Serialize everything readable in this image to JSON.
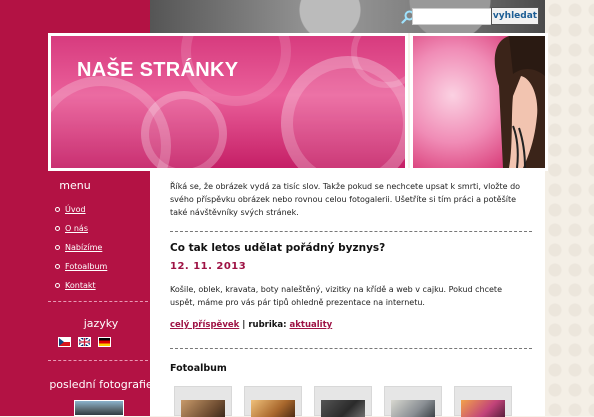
{
  "search": {
    "placeholder": "",
    "button_label": "vyhledat"
  },
  "header": {
    "site_title": "NAŠE STRÁNKY"
  },
  "sidebar": {
    "menu_heading": "menu",
    "items": [
      {
        "label": "Úvod"
      },
      {
        "label": "O nás"
      },
      {
        "label": "Nabízíme"
      },
      {
        "label": "Fotoalbum"
      },
      {
        "label": "Kontakt"
      }
    ],
    "languages_heading": "jazyky",
    "languages": [
      "cs",
      "en",
      "de"
    ],
    "recent_photos_heading": "poslední fotografie"
  },
  "content": {
    "intro": "Říká se, že obrázek vydá za tisíc slov. Takže pokud se nechcete upsat k smrti, vložte do svého příspěvku obrázek nebo rovnou celou fotogalerii. Ušetříte si tím práci a potěšíte také návštěvníky svých stránek.",
    "post": {
      "title": "Co tak letos udělat pořádný byznys?",
      "date": "12. 11. 2013",
      "body": "Košile, oblek, kravata, boty naleštěný, vizitky na křídě a web v cajku. Pokud chcete uspět, máme pro vás pár tipů ohledně prezentace na internetu.",
      "full_post_link": "celý příspěvek",
      "category_label": "rubrika:",
      "category_link": "aktuality"
    },
    "album": {
      "title": "Fotoalbum"
    }
  },
  "colors": {
    "brand": "#b31244",
    "accent": "#9e1244",
    "link_blue": "#1c5d94"
  }
}
